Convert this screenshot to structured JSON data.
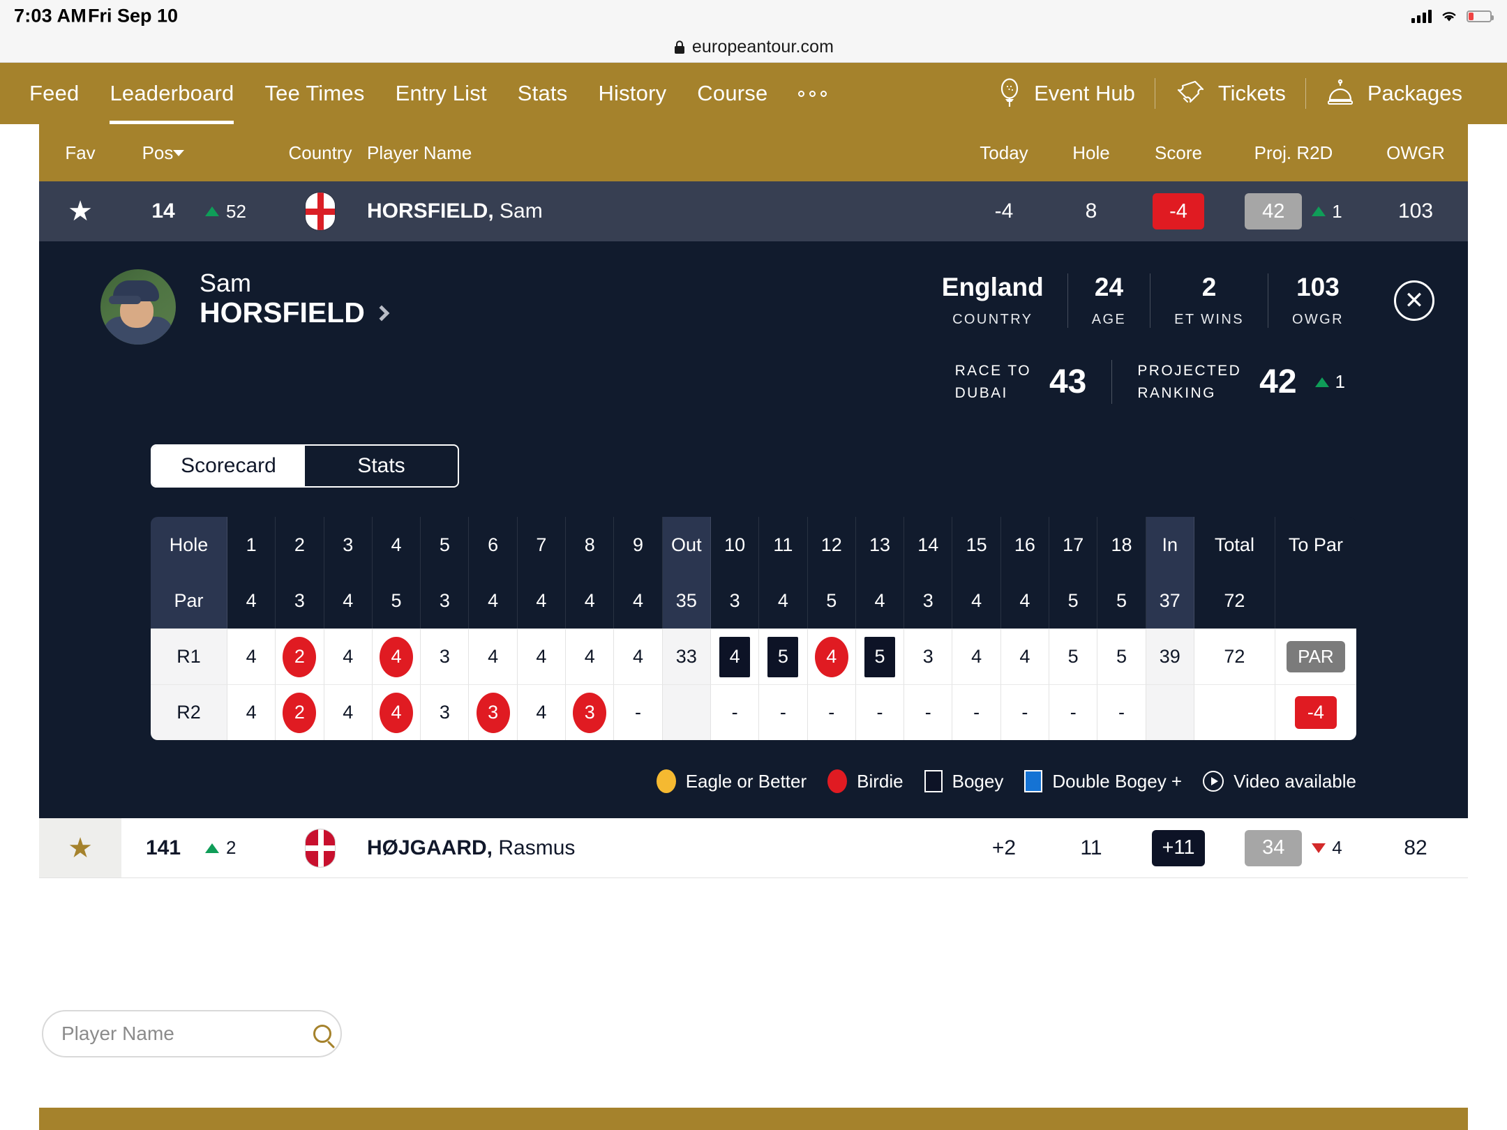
{
  "status_bar": {
    "time": "7:03 AM",
    "date": "Fri Sep 10",
    "signal_icon": "cellular-bars-icon",
    "wifi_icon": "wifi-icon",
    "battery_icon": "battery-low-icon"
  },
  "browser": {
    "lock_icon": "lock-icon",
    "url": "europeantour.com"
  },
  "nav": {
    "items": [
      {
        "label": "Feed",
        "active": false
      },
      {
        "label": "Leaderboard",
        "active": true
      },
      {
        "label": "Tee Times",
        "active": false
      },
      {
        "label": "Entry List",
        "active": false
      },
      {
        "label": "Stats",
        "active": false
      },
      {
        "label": "History",
        "active": false
      },
      {
        "label": "Course",
        "active": false
      }
    ],
    "overflow_icon": "more-dots-icon",
    "actions": [
      {
        "label": "Event Hub",
        "icon": "golf-tee-icon"
      },
      {
        "label": "Tickets",
        "icon": "ticket-icon"
      },
      {
        "label": "Packages",
        "icon": "bell-service-icon"
      }
    ]
  },
  "leaderboard": {
    "columns": {
      "fav": "Fav",
      "pos": "Pos",
      "country": "Country",
      "player_name": "Player Name",
      "today": "Today",
      "hole": "Hole",
      "score": "Score",
      "proj_r2d": "Proj. R2D",
      "owgr": "OWGR"
    },
    "sort_icon": "sort-desc-caret-icon",
    "rows": [
      {
        "selected": true,
        "fav_icon": "star-filled-icon",
        "pos": "14",
        "move_dir": "up",
        "move": "52",
        "country_flag": "england-flag-icon",
        "last_name": "HORSFIELD,",
        "first_name": "Sam",
        "today": "-4",
        "hole": "8",
        "score": "-4",
        "score_style": "red",
        "proj_r2d": "42",
        "proj_style": "gray",
        "proj_move_dir": "up",
        "proj_move": "1",
        "owgr": "103"
      },
      {
        "selected": false,
        "fav_icon": "star-filled-icon",
        "pos": "141",
        "move_dir": "up",
        "move": "2",
        "country_flag": "denmark-flag-icon",
        "last_name": "HØJGAARD,",
        "first_name": "Rasmus",
        "today": "+2",
        "hole": "11",
        "score": "+11",
        "score_style": "navy",
        "proj_r2d": "34",
        "proj_style": "gray",
        "proj_move_dir": "down",
        "proj_move": "4",
        "owgr": "82"
      }
    ]
  },
  "detail": {
    "avatar_alt": "player-headshot",
    "first_name": "Sam",
    "last_name": "HORSFIELD",
    "profile_chevron_icon": "chevron-right-icon",
    "close_icon": "close-x-icon",
    "stats": [
      {
        "value": "England",
        "label": "COUNTRY"
      },
      {
        "value": "24",
        "label": "AGE"
      },
      {
        "value": "2",
        "label": "ET WINS"
      },
      {
        "value": "103",
        "label": "OWGR"
      }
    ],
    "rankings": [
      {
        "label_line1": "RACE TO",
        "label_line2": "DUBAI",
        "value": "43",
        "move_dir": "",
        "move": ""
      },
      {
        "label_line1": "PROJECTED",
        "label_line2": "RANKING",
        "value": "42",
        "move_dir": "up",
        "move": "1"
      }
    ],
    "tabs": [
      {
        "label": "Scorecard",
        "active": true
      },
      {
        "label": "Stats",
        "active": false
      }
    ],
    "legend": [
      {
        "label": "Eagle or Better",
        "swatch": "eagle-swatch-icon"
      },
      {
        "label": "Birdie",
        "swatch": "birdie-swatch-icon"
      },
      {
        "label": "Bogey",
        "swatch": "bogey-swatch-icon"
      },
      {
        "label": "Double Bogey +",
        "swatch": "double-bogey-swatch-icon"
      },
      {
        "label": "Video available",
        "swatch": "video-play-icon"
      }
    ]
  },
  "scorecard": {
    "row_labels": {
      "hole": "Hole",
      "par": "Par",
      "r1": "R1",
      "r2": "R2"
    },
    "out_label": "Out",
    "in_label": "In",
    "total_label": "Total",
    "topar_label": "To Par",
    "holes_front": [
      "1",
      "2",
      "3",
      "4",
      "5",
      "6",
      "7",
      "8",
      "9"
    ],
    "holes_back": [
      "10",
      "11",
      "12",
      "13",
      "14",
      "15",
      "16",
      "17",
      "18"
    ],
    "par_front": [
      "4",
      "3",
      "4",
      "5",
      "3",
      "4",
      "4",
      "4",
      "4"
    ],
    "par_out": "35",
    "par_back": [
      "3",
      "4",
      "5",
      "4",
      "3",
      "4",
      "4",
      "5",
      "5"
    ],
    "par_in": "37",
    "par_total": "72",
    "par_topar": "",
    "rounds": [
      {
        "label": "R1",
        "front": [
          {
            "v": "4",
            "m": ""
          },
          {
            "v": "2",
            "m": "birdie"
          },
          {
            "v": "4",
            "m": ""
          },
          {
            "v": "4",
            "m": "birdie"
          },
          {
            "v": "3",
            "m": ""
          },
          {
            "v": "4",
            "m": ""
          },
          {
            "v": "4",
            "m": ""
          },
          {
            "v": "4",
            "m": ""
          },
          {
            "v": "4",
            "m": ""
          }
        ],
        "out": "33",
        "back": [
          {
            "v": "4",
            "m": "bogey"
          },
          {
            "v": "5",
            "m": "bogey"
          },
          {
            "v": "4",
            "m": "birdie"
          },
          {
            "v": "5",
            "m": "bogey"
          },
          {
            "v": "3",
            "m": ""
          },
          {
            "v": "4",
            "m": ""
          },
          {
            "v": "4",
            "m": ""
          },
          {
            "v": "5",
            "m": ""
          },
          {
            "v": "5",
            "m": ""
          }
        ],
        "in": "39",
        "total": "72",
        "topar": "PAR",
        "topar_style": "par"
      },
      {
        "label": "R2",
        "front": [
          {
            "v": "4",
            "m": ""
          },
          {
            "v": "2",
            "m": "birdie"
          },
          {
            "v": "4",
            "m": ""
          },
          {
            "v": "4",
            "m": "birdie"
          },
          {
            "v": "3",
            "m": ""
          },
          {
            "v": "3",
            "m": "birdie"
          },
          {
            "v": "4",
            "m": ""
          },
          {
            "v": "3",
            "m": "birdie"
          },
          {
            "v": "-",
            "m": ""
          }
        ],
        "out": "",
        "back": [
          {
            "v": "-",
            "m": ""
          },
          {
            "v": "-",
            "m": ""
          },
          {
            "v": "-",
            "m": ""
          },
          {
            "v": "-",
            "m": ""
          },
          {
            "v": "-",
            "m": ""
          },
          {
            "v": "-",
            "m": ""
          },
          {
            "v": "-",
            "m": ""
          },
          {
            "v": "-",
            "m": ""
          },
          {
            "v": "-",
            "m": ""
          }
        ],
        "in": "",
        "total": "",
        "topar": "-4",
        "topar_style": "red"
      }
    ]
  },
  "search": {
    "placeholder": "Player Name",
    "value": "",
    "icon": "search-icon"
  },
  "colors": {
    "brand_gold": "#a5822c",
    "detail_navy": "#111b2d",
    "row_selected": "#373f52",
    "birdie_red": "#e01b22",
    "bogey_navy": "#0d1326",
    "eagle_yellow": "#f5b931",
    "double_bogey_blue": "#1573d4",
    "up_green": "#0f9d58",
    "down_red": "#d32a2a"
  }
}
